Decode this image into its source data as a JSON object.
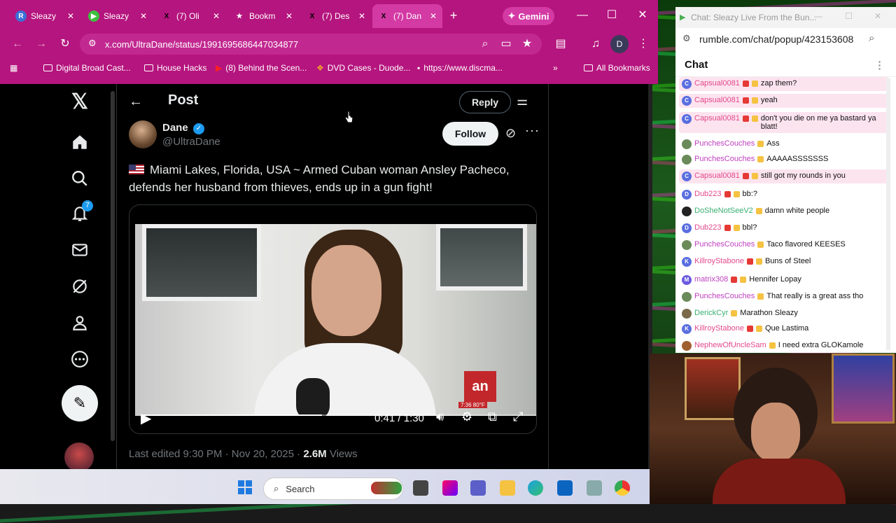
{
  "browser": {
    "tabs": [
      {
        "label": "Sleazy",
        "icon": "R",
        "icon_color": "#3b6fd8"
      },
      {
        "label": "Sleazy",
        "icon": "▶",
        "icon_color": "#3fbf3f"
      },
      {
        "label": "(7) Oli",
        "icon": "X",
        "icon_color": "#000000"
      },
      {
        "label": "Bookm",
        "icon": "★",
        "icon_color": "#000000"
      },
      {
        "label": "(7) Des",
        "icon": "X",
        "icon_color": "#000000"
      },
      {
        "label": "(7) Dan",
        "icon": "X",
        "icon_color": "#000000"
      }
    ],
    "gemini_label": "Gemini",
    "url": "x.com/UltraDane/status/1991695686447034877",
    "bookmarks": [
      "Digital Broad Cast...",
      "House Hacks",
      "(8) Behind the Scen...",
      "DVD Cases - Duode...",
      "https://www.discma..."
    ],
    "all_bookmarks": "All Bookmarks",
    "profile_initial": "D"
  },
  "post": {
    "header_title": "Post",
    "reply_label": "Reply",
    "author_name": "Dane",
    "author_handle": "@UltraDane",
    "follow_label": "Follow",
    "text": "Miami Lakes, Florida, USA ~ Armed Cuban woman Ansley Pacheco, defends her husband from thieves, ends up in a gun fight!",
    "video": {
      "timecode": "0:41 / 1:30",
      "progress": 0.455,
      "logo": "an",
      "logo_caption": "7:36 80°F"
    },
    "meta_time": "Last edited 9:30 PM · Nov 20, 2025 · ",
    "meta_views_count": "2.6M",
    "meta_views_label": " Views"
  },
  "sidebar": {
    "notification_count": "7"
  },
  "taskbar": {
    "search_label": "Search"
  },
  "chat_window": {
    "title": "Chat: Sleazy Live From the Bun...",
    "url": "rumble.com/chat/popup/423153608",
    "header": "Chat",
    "messages": [
      {
        "user": "Capsual0081",
        "text": "zap them?",
        "color": "#e3488c",
        "avatar": "C",
        "avatar_color": "#5a6ee0",
        "highlight": true
      },
      {
        "user": "Capsual0081",
        "text": "yeah",
        "color": "#e3488c",
        "avatar": "C",
        "avatar_color": "#5a6ee0",
        "highlight": true
      },
      {
        "user": "Capsual0081",
        "text": "don't you die on me ya bastard ya blatt!",
        "color": "#e3488c",
        "avatar": "C",
        "avatar_color": "#5a6ee0",
        "highlight": true
      },
      {
        "user": "PunchesCouches",
        "text": "Ass",
        "color": "#c040c0",
        "avatar": "",
        "avatar_color": "#6a8a5a",
        "highlight": false
      },
      {
        "user": "PunchesCouches",
        "text": "AAAAASSSSSSS",
        "color": "#c040c0",
        "avatar": "",
        "avatar_color": "#6a8a5a",
        "highlight": false
      },
      {
        "user": "Capsual0081",
        "text": "still got my rounds in you",
        "color": "#e3488c",
        "avatar": "C",
        "avatar_color": "#5a6ee0",
        "highlight": true
      },
      {
        "user": "Dub223",
        "text": "bb:?",
        "color": "#e3488c",
        "avatar": "D",
        "avatar_color": "#5a6ee0",
        "highlight": false
      },
      {
        "user": "DoSheNotSeeV2",
        "text": "damn white people",
        "color": "#38b070",
        "avatar": "",
        "avatar_color": "#222222",
        "highlight": false
      },
      {
        "user": "Dub223",
        "text": "bbl?",
        "color": "#e3488c",
        "avatar": "D",
        "avatar_color": "#5a6ee0",
        "highlight": false
      },
      {
        "user": "PunchesCouches",
        "text": "Taco flavored KEESES",
        "color": "#c040c0",
        "avatar": "",
        "avatar_color": "#6a8a5a",
        "highlight": false
      },
      {
        "user": "KillroyStabone",
        "text": "Buns of Steel",
        "color": "#e3488c",
        "avatar": "K",
        "avatar_color": "#5a6ee0",
        "highlight": false
      },
      {
        "user": "matrix308",
        "text": "Hennifer Lopay",
        "color": "#c040c0",
        "avatar": "M",
        "avatar_color": "#6a5ae0",
        "highlight": false
      },
      {
        "user": "PunchesCouches",
        "text": "That really is a great ass tho",
        "color": "#c040c0",
        "avatar": "",
        "avatar_color": "#6a8a5a",
        "highlight": false
      },
      {
        "user": "DerickCyr",
        "text": "Marathon Sleazy",
        "color": "#38b070",
        "avatar": "",
        "avatar_color": "#7a6a4a",
        "highlight": false
      },
      {
        "user": "KillroyStabone",
        "text": "Que Lastima",
        "color": "#e3488c",
        "avatar": "K",
        "avatar_color": "#5a6ee0",
        "highlight": false
      },
      {
        "user": "NephewOfUncleSam",
        "text": "I need extra GLOKamole",
        "color": "#e3488c",
        "avatar": "",
        "avatar_color": "#a06030",
        "highlight": false
      }
    ]
  },
  "colors": {
    "chrome": "#b5157e",
    "x_bg": "#000000",
    "accent_blue": "#1d9bf0"
  }
}
